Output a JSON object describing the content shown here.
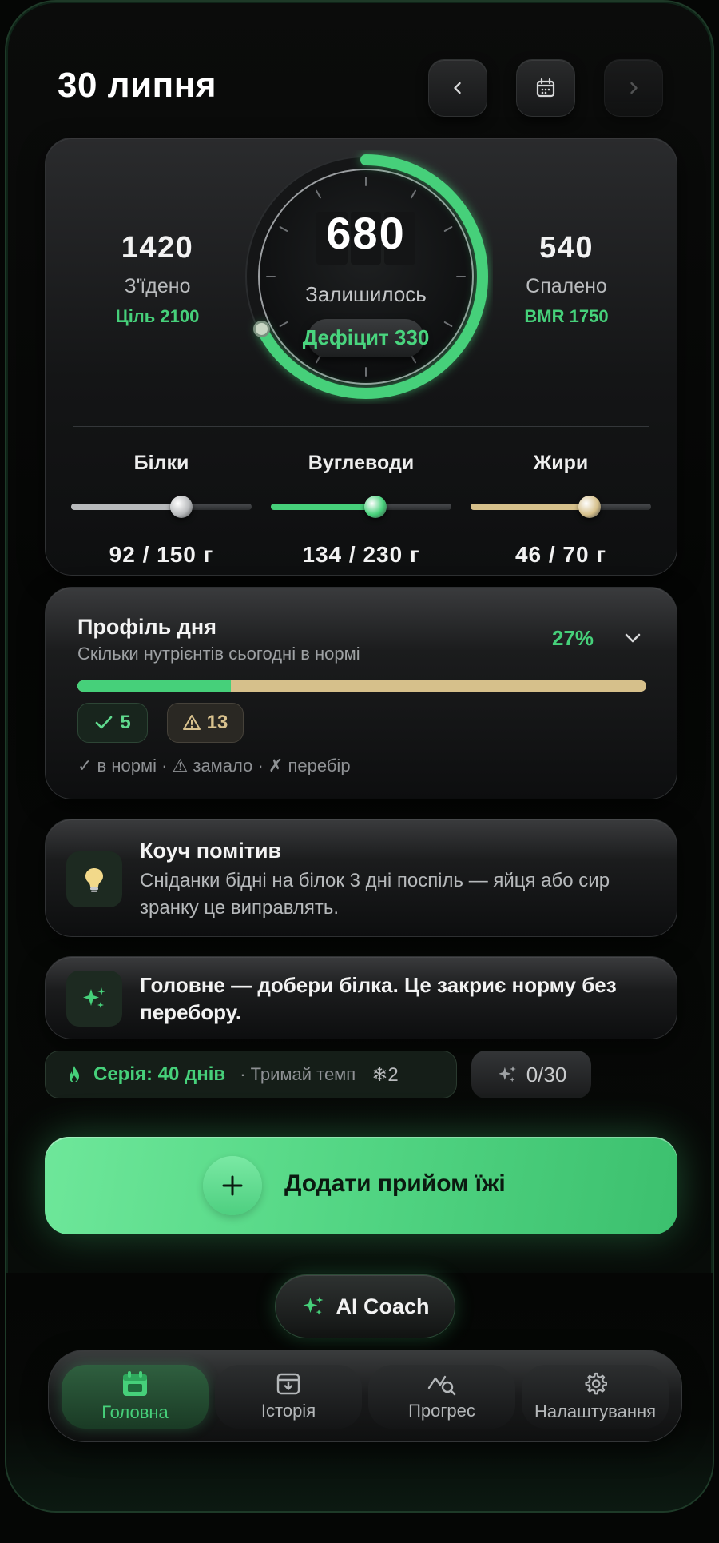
{
  "header": {
    "date": "30 липня",
    "prev_icon": "chevron-left-icon",
    "calendar_icon": "calendar-icon",
    "next_icon": "chevron-right-icon"
  },
  "calories": {
    "eaten": {
      "value": "1420",
      "label": "З'їдено",
      "sub": "Ціль 2100"
    },
    "remaining": {
      "value": "680",
      "label": "Залишилось",
      "pill": "Дефіцит 330",
      "progress": 0.676
    },
    "burned": {
      "value": "540",
      "label": "Спалено",
      "sub": "BMR 1750"
    }
  },
  "macros": [
    {
      "name": "Білки",
      "value": "92 / 150 г",
      "fraction": 0.61,
      "color": "#b8babc"
    },
    {
      "name": "Вуглеводи",
      "value": "134 / 230 г",
      "fraction": 0.58,
      "color": "#46d07a"
    },
    {
      "name": "Жири",
      "value": "46 / 70 г",
      "fraction": 0.66,
      "color": "#d6c08b"
    }
  ],
  "profile": {
    "title": "Профіль дня",
    "subtitle": "Скільки нутрієнтів сьогодні в нормі",
    "percent": "27%",
    "percent_value": 0.27,
    "ok_count": "5",
    "warn_count": "13",
    "legend": "✓ в нормі · ⚠ замало · ✗ перебір"
  },
  "coach": {
    "title": "Коуч помітив",
    "text": "Сніданки бідні на білок 3 дні поспіль — яйця або сир зранку це виправлять.",
    "icon": "lightbulb-icon"
  },
  "tip": {
    "text": "Головне — добери білка. Це закриє норму без перебору.",
    "icon": "sparkles-icon"
  },
  "streak": {
    "main": "Серія: 40 днів",
    "sub": "· Тримай темп",
    "freezes": "❄2",
    "sparks": "0/30"
  },
  "add_meal": {
    "label": "Додати прийом їжі"
  },
  "ai_coach": {
    "label": "AI Coach"
  },
  "tabs": [
    {
      "label": "Головна",
      "icon": "calendar-icon",
      "active": true
    },
    {
      "label": "Історія",
      "icon": "archive-icon",
      "active": false
    },
    {
      "label": "Прогрес",
      "icon": "trend-search-icon",
      "active": false
    },
    {
      "label": "Налаштування",
      "icon": "gear-icon",
      "active": false
    }
  ],
  "colors": {
    "accent": "#46d07a",
    "warn": "#d6c08b",
    "bg": "#050605"
  }
}
